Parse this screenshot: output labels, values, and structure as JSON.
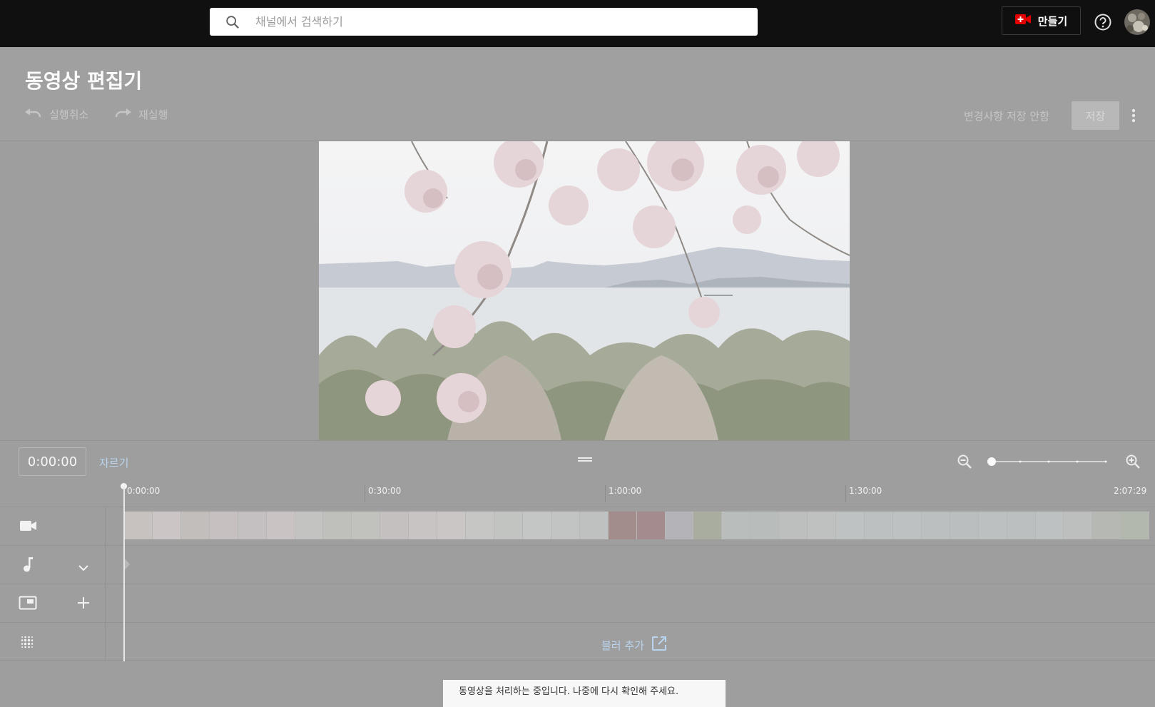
{
  "topbar": {
    "search_placeholder": "채널에서 검색하기",
    "create_label": "만들기",
    "icons": {
      "search": "search-icon",
      "create": "video-plus-icon",
      "help": "help-icon",
      "avatar": "avatar"
    }
  },
  "header": {
    "title": "동영상 편집기",
    "undo_label": "실행취소",
    "redo_label": "재실행",
    "status": "변경사항 저장 안함",
    "save_label": "저장"
  },
  "timeline": {
    "timecode": "0:00:00",
    "trim_label": "자르기",
    "ruler": [
      "0:00:00",
      "0:30:00",
      "1:00:00",
      "1:30:00",
      "2:07:29"
    ],
    "blur_label": "블러 추가",
    "zoom_level": 0
  },
  "toast": {
    "message": "동영상을 처리하는 중입니다. 나중에 다시 확인해 주세요."
  },
  "colors": {
    "accent_link": "#b9d4ee",
    "create_icon": "#e00000",
    "overlay": "#9e9e9e"
  }
}
